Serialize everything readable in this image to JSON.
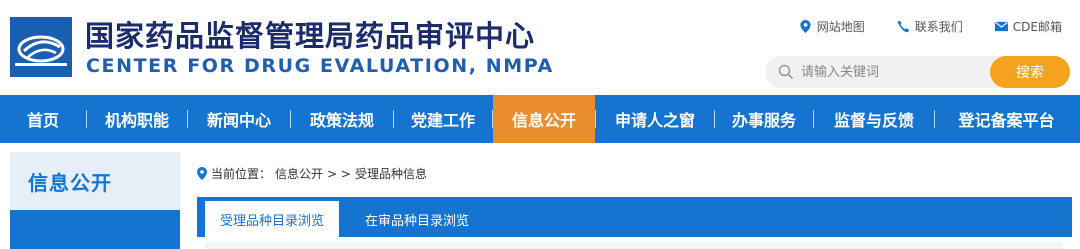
{
  "header": {
    "title_cn": "国家药品监督管理局药品审评中心",
    "title_en": "CENTER FOR DRUG EVALUATION, NMPA",
    "logo_icon": "nmpa-logo-icon"
  },
  "toplinks": [
    {
      "label": "网站地图",
      "icon": "map-pin-icon"
    },
    {
      "label": "联系我们",
      "icon": "phone-icon"
    },
    {
      "label": "CDE邮箱",
      "icon": "mail-icon"
    }
  ],
  "search": {
    "placeholder": "请输入关键词",
    "button_label": "搜索"
  },
  "nav": {
    "items": [
      {
        "label": "首页"
      },
      {
        "label": "机构职能"
      },
      {
        "label": "新闻中心"
      },
      {
        "label": "政策法规"
      },
      {
        "label": "党建工作"
      },
      {
        "label": "信息公开"
      },
      {
        "label": "申请人之窗"
      },
      {
        "label": "办事服务"
      },
      {
        "label": "监督与反馈"
      },
      {
        "label": "登记备案平台"
      }
    ],
    "active_index": 5
  },
  "sidebar": {
    "title": "信息公开"
  },
  "breadcrumb": {
    "prefix": "当前位置：",
    "parent": "信息公开",
    "separator": "> >",
    "current": "受理品种信息"
  },
  "tabs": [
    {
      "label": "受理品种目录浏览",
      "active": true
    },
    {
      "label": "在审品种目录浏览",
      "active": false
    }
  ],
  "colors": {
    "primary": "#1474cf",
    "accent": "#e98d2f",
    "search_button": "#f6a21e",
    "title": "#1b2b6b"
  }
}
